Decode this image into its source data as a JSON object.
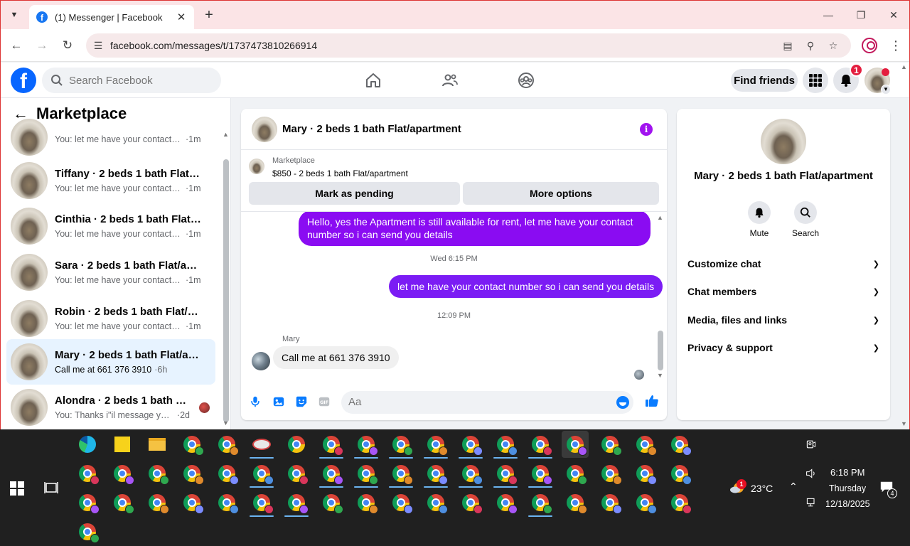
{
  "browser": {
    "tab_title": "(1) Messenger | Facebook",
    "tab_favicon": "facebook-icon",
    "url": "facebook.com/messages/t/1737473810266914",
    "new_tab_label": "+"
  },
  "fb": {
    "search_placeholder": "Search Facebook",
    "find_friends_label": "Find friends",
    "notification_count": "1",
    "brand_color": "#0866ff"
  },
  "sidebar": {
    "title": "Marketplace",
    "conversations": [
      {
        "name": "",
        "preview": "You: let me have your contact nu...",
        "time": "·1m"
      },
      {
        "name": "Tiffany · 2 beds 1 bath Flat/apar...",
        "preview": "You: let me have your contact nu...",
        "time": "·1m"
      },
      {
        "name": "Cinthia · 2 beds 1 bath Flat/apar...",
        "preview": "You: let me have your contact nu...",
        "time": "·1m"
      },
      {
        "name": "Sara · 2 beds 1 bath Flat/apartm...",
        "preview": "You: let me have your contact nu...",
        "time": "·1m"
      },
      {
        "name": "Robin · 2 beds 1 bath Flat/apart...",
        "preview": "You: let me have your contact nu...",
        "time": "·1m"
      },
      {
        "name": "Mary · 2 beds 1 bath Flat/apart...",
        "preview": "Call me at 661 376 3910",
        "time": "·6h"
      },
      {
        "name": "Alondra · 2 beds 1 bath Flat/a...",
        "preview": "You: Thanks i\"il message you in ...",
        "time": "·2d"
      }
    ]
  },
  "chat": {
    "title": "Mary · 2 beds 1 bath Flat/apartment",
    "marketplace_label": "Marketplace",
    "listing": "$850 - 2 beds 1 bath Flat/apartment",
    "mark_pending_label": "Mark as pending",
    "more_options_label": "More options",
    "messages": {
      "out1": "Hello, yes the Apartment is still available for rent, let me have your contact number so i can send you details",
      "ts1": "Wed 6:15 PM",
      "out2": "let me have your contact number so i can send you details",
      "ts2": "12:09 PM",
      "sender": "Mary",
      "in1": "Call me at 661 376 3910"
    },
    "composer_placeholder": "Aa",
    "accent_color": "#8a0cf2"
  },
  "info_panel": {
    "name": "Mary · 2 beds 1 bath Flat/apartment",
    "mute_label": "Mute",
    "search_label": "Search",
    "sections": [
      "Customize chat",
      "Chat members",
      "Media, files and links",
      "Privacy & support"
    ]
  },
  "taskbar": {
    "weather_temp": "23°C",
    "time": "6:18 PM",
    "day": "Thursday",
    "date": "12/18/2025",
    "notification_count": "4",
    "weather_badge": "1"
  }
}
